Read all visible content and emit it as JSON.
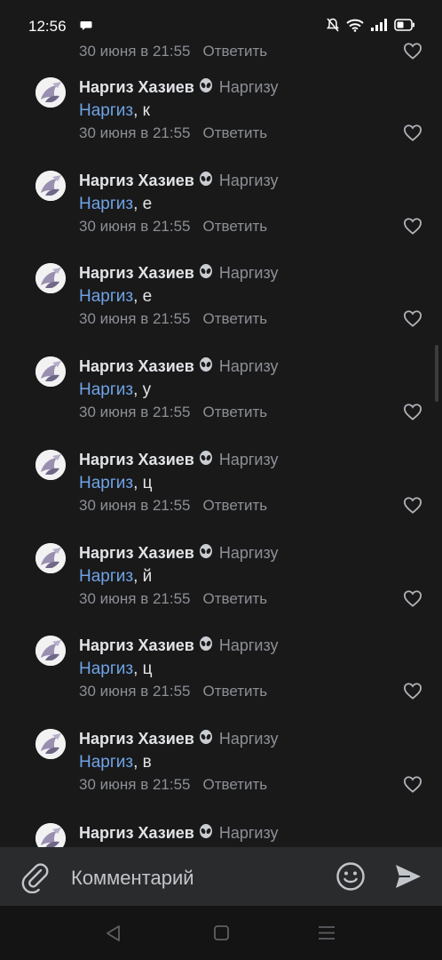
{
  "status_bar": {
    "time": "12:56"
  },
  "thread": {
    "partial_top": {
      "date": "30 июня в 21:55",
      "reply_label": "Ответить"
    },
    "comments": [
      {
        "author": "Наргиз Хазиев",
        "reply_to": "Наргизу",
        "mention": "Наргиз",
        "text": ", к",
        "date": "30 июня в 21:55",
        "reply_label": "Ответить"
      },
      {
        "author": "Наргиз Хазиев",
        "reply_to": "Наргизу",
        "mention": "Наргиз",
        "text": ", е",
        "date": "30 июня в 21:55",
        "reply_label": "Ответить"
      },
      {
        "author": "Наргиз Хазиев",
        "reply_to": "Наргизу",
        "mention": "Наргиз",
        "text": ", е",
        "date": "30 июня в 21:55",
        "reply_label": "Ответить"
      },
      {
        "author": "Наргиз Хазиев",
        "reply_to": "Наргизу",
        "mention": "Наргиз",
        "text": ", у",
        "date": "30 июня в 21:55",
        "reply_label": "Ответить"
      },
      {
        "author": "Наргиз Хазиев",
        "reply_to": "Наргизу",
        "mention": "Наргиз",
        "text": ", ц",
        "date": "30 июня в 21:55",
        "reply_label": "Ответить"
      },
      {
        "author": "Наргиз Хазиев",
        "reply_to": "Наргизу",
        "mention": "Наргиз",
        "text": ", й",
        "date": "30 июня в 21:55",
        "reply_label": "Ответить"
      },
      {
        "author": "Наргиз Хазиев",
        "reply_to": "Наргизу",
        "mention": "Наргиз",
        "text": ", ц",
        "date": "30 июня в 21:55",
        "reply_label": "Ответить"
      },
      {
        "author": "Наргиз Хазиев",
        "reply_to": "Наргизу",
        "mention": "Наргиз",
        "text": ", в",
        "date": "30 июня в 21:55",
        "reply_label": "Ответить"
      }
    ],
    "partial_bottom": {
      "author": "Наргиз Хазиев",
      "reply_to": "Наргизу"
    }
  },
  "composer": {
    "placeholder": "Комментарий"
  },
  "colors": {
    "background": "#19191a",
    "mention": "#6fa4e6",
    "secondary_text": "#8c8f94",
    "composer_bg": "#2a2b2d"
  },
  "icons": {
    "author_emoji": "alien-icon",
    "like": "heart-icon",
    "attach": "paperclip-icon",
    "emoji_picker": "smile-icon",
    "send": "send-icon"
  }
}
